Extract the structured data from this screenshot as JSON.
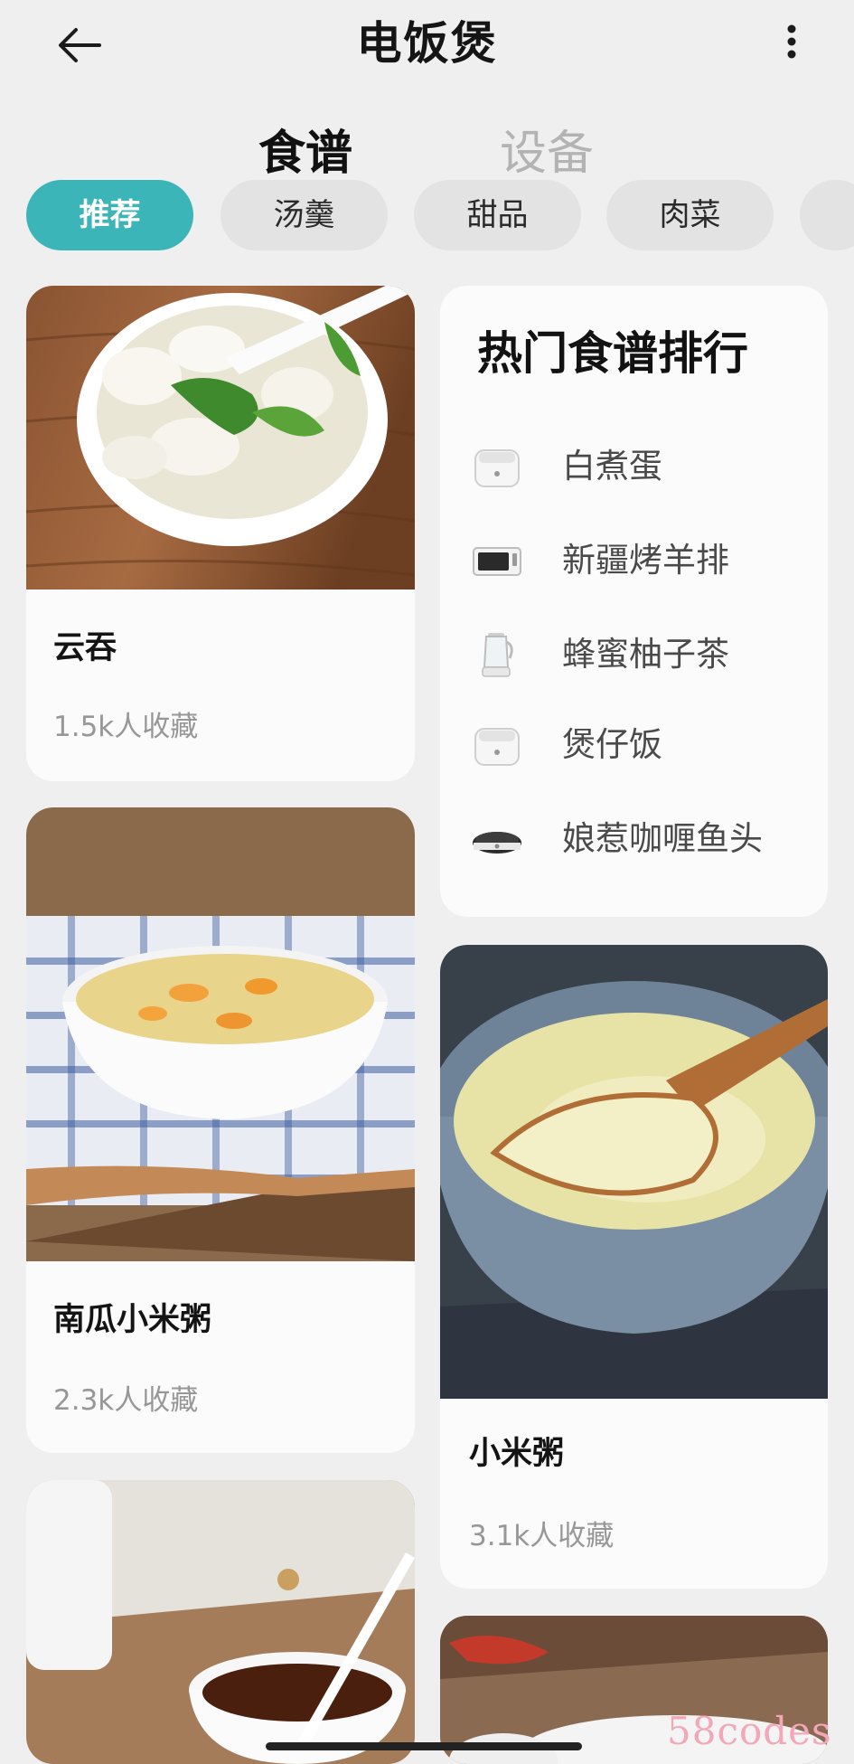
{
  "header": {
    "title": "电饭煲"
  },
  "tabs": [
    {
      "label": "食谱",
      "active": true
    },
    {
      "label": "设备",
      "active": false
    }
  ],
  "chips": [
    {
      "label": "推荐",
      "active": true
    },
    {
      "label": "汤羹",
      "active": false
    },
    {
      "label": "甜品",
      "active": false
    },
    {
      "label": "肉菜",
      "active": false
    }
  ],
  "recipes": [
    {
      "name": "云吞",
      "favorites": "1.5k人收藏"
    },
    {
      "name": "南瓜小米粥",
      "favorites": "2.3k人收藏"
    },
    {
      "name": "小米粥",
      "favorites": "3.1k人收藏"
    }
  ],
  "ranking": {
    "title": "热门食谱排行",
    "items": [
      {
        "label": "白煮蛋",
        "icon": "rice-cooker-icon"
      },
      {
        "label": "新疆烤羊排",
        "icon": "oven-icon"
      },
      {
        "label": "蜂蜜柚子茶",
        "icon": "kettle-icon"
      },
      {
        "label": "煲仔饭",
        "icon": "rice-cooker-icon"
      },
      {
        "label": "娘惹咖喱鱼头",
        "icon": "induction-cooker-icon"
      }
    ]
  },
  "watermark": "58codes",
  "colors": {
    "accent": "#3bb5b8",
    "background": "#efefef",
    "card": "#fbfbfb"
  }
}
